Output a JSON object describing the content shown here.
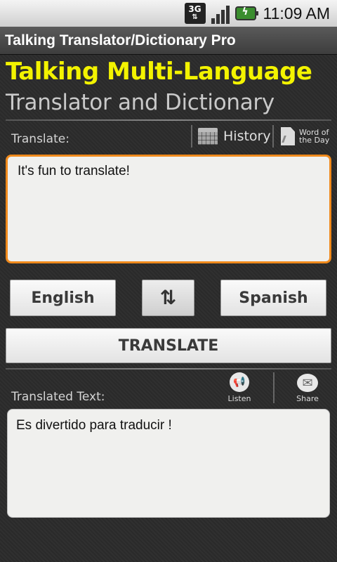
{
  "status": {
    "network": "3G",
    "time": "11:09 AM"
  },
  "app_title": "Talking Translator/Dictionary Pro",
  "header": {
    "line1": "Talking Multi-Language",
    "line2": "Translator and Dictionary"
  },
  "source": {
    "label": "Translate:",
    "history_label": "History",
    "word_of_day_label": "Word of the Day",
    "text": "It's fun to translate!"
  },
  "languages": {
    "from": "English",
    "to": "Spanish"
  },
  "translate_button": "TRANSLATE",
  "result": {
    "label": "Translated Text:",
    "listen_label": "Listen",
    "share_label": "Share",
    "text": "Es divertido para traducir !"
  },
  "colors": {
    "heading_yellow": "#f3f300",
    "source_border": "#f08a1c"
  }
}
